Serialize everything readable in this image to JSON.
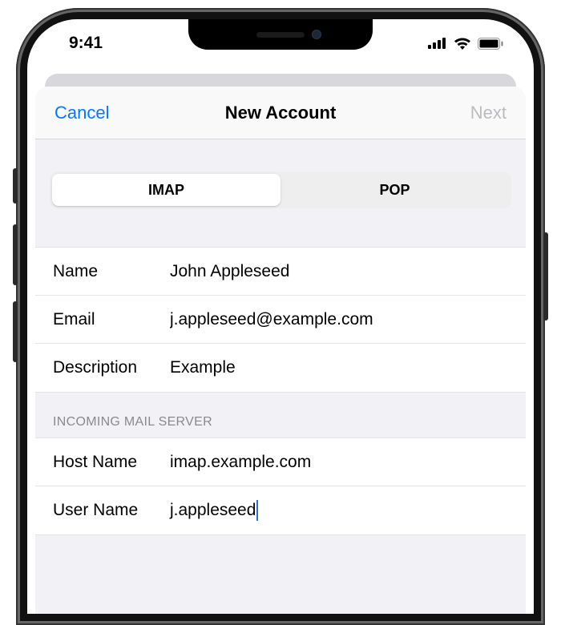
{
  "status": {
    "time": "9:41"
  },
  "nav": {
    "cancel": "Cancel",
    "title": "New Account",
    "next": "Next"
  },
  "segments": {
    "imap": "IMAP",
    "pop": "POP",
    "selected": "IMAP"
  },
  "fields": {
    "name_label": "Name",
    "name_value": "John Appleseed",
    "email_label": "Email",
    "email_value": "j.appleseed@example.com",
    "description_label": "Description",
    "description_value": "Example"
  },
  "incoming": {
    "header": "INCOMING MAIL SERVER",
    "host_label": "Host Name",
    "host_value": "imap.example.com",
    "user_label": "User Name",
    "user_value": "j.appleseed"
  }
}
